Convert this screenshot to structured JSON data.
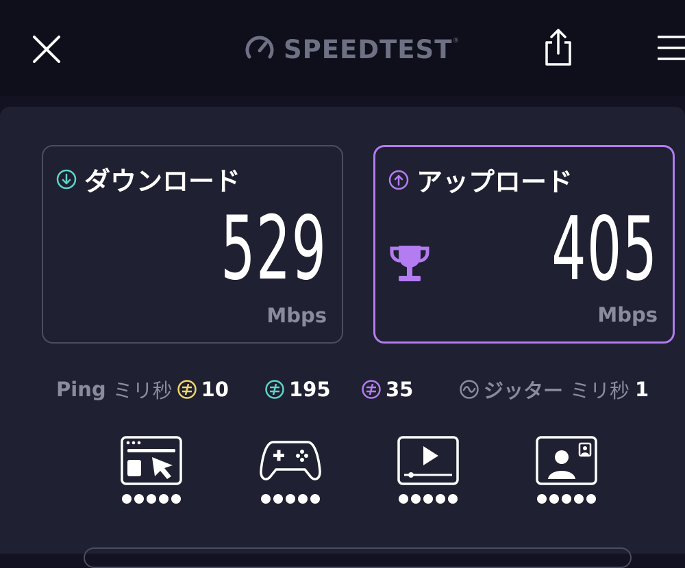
{
  "header": {
    "logo_text": "SPEEDTEST",
    "logo_tm": "®",
    "close_icon": "close-icon",
    "share_icon": "share-icon",
    "menu_icon": "hamburger-menu-icon"
  },
  "download": {
    "title": "ダウンロード",
    "value": "529",
    "unit": "Mbps",
    "icon": "download-arrow-icon",
    "accent": "#5fd3c9"
  },
  "upload": {
    "title": "アップロード",
    "value": "405",
    "unit": "Mbps",
    "icon": "upload-arrow-icon",
    "accent": "#b37cf0",
    "trophy_icon": "trophy-icon"
  },
  "ping": {
    "label": "Ping",
    "unit": "ミリ秒",
    "idle": "10",
    "download": "195",
    "upload": "35",
    "idle_color": "#f2d56b",
    "download_color": "#5fd3c9",
    "upload_color": "#b37cf0"
  },
  "jitter": {
    "label": "ジッター",
    "unit": "ミリ秒",
    "value": "1"
  },
  "apps": [
    {
      "name": "web-browsing",
      "icon": "web-browsing-icon",
      "rating": 5
    },
    {
      "name": "gaming",
      "icon": "gamepad-icon",
      "rating": 5
    },
    {
      "name": "video-streaming",
      "icon": "video-player-icon",
      "rating": 5
    },
    {
      "name": "video-chat",
      "icon": "video-chat-icon",
      "rating": 5
    }
  ]
}
